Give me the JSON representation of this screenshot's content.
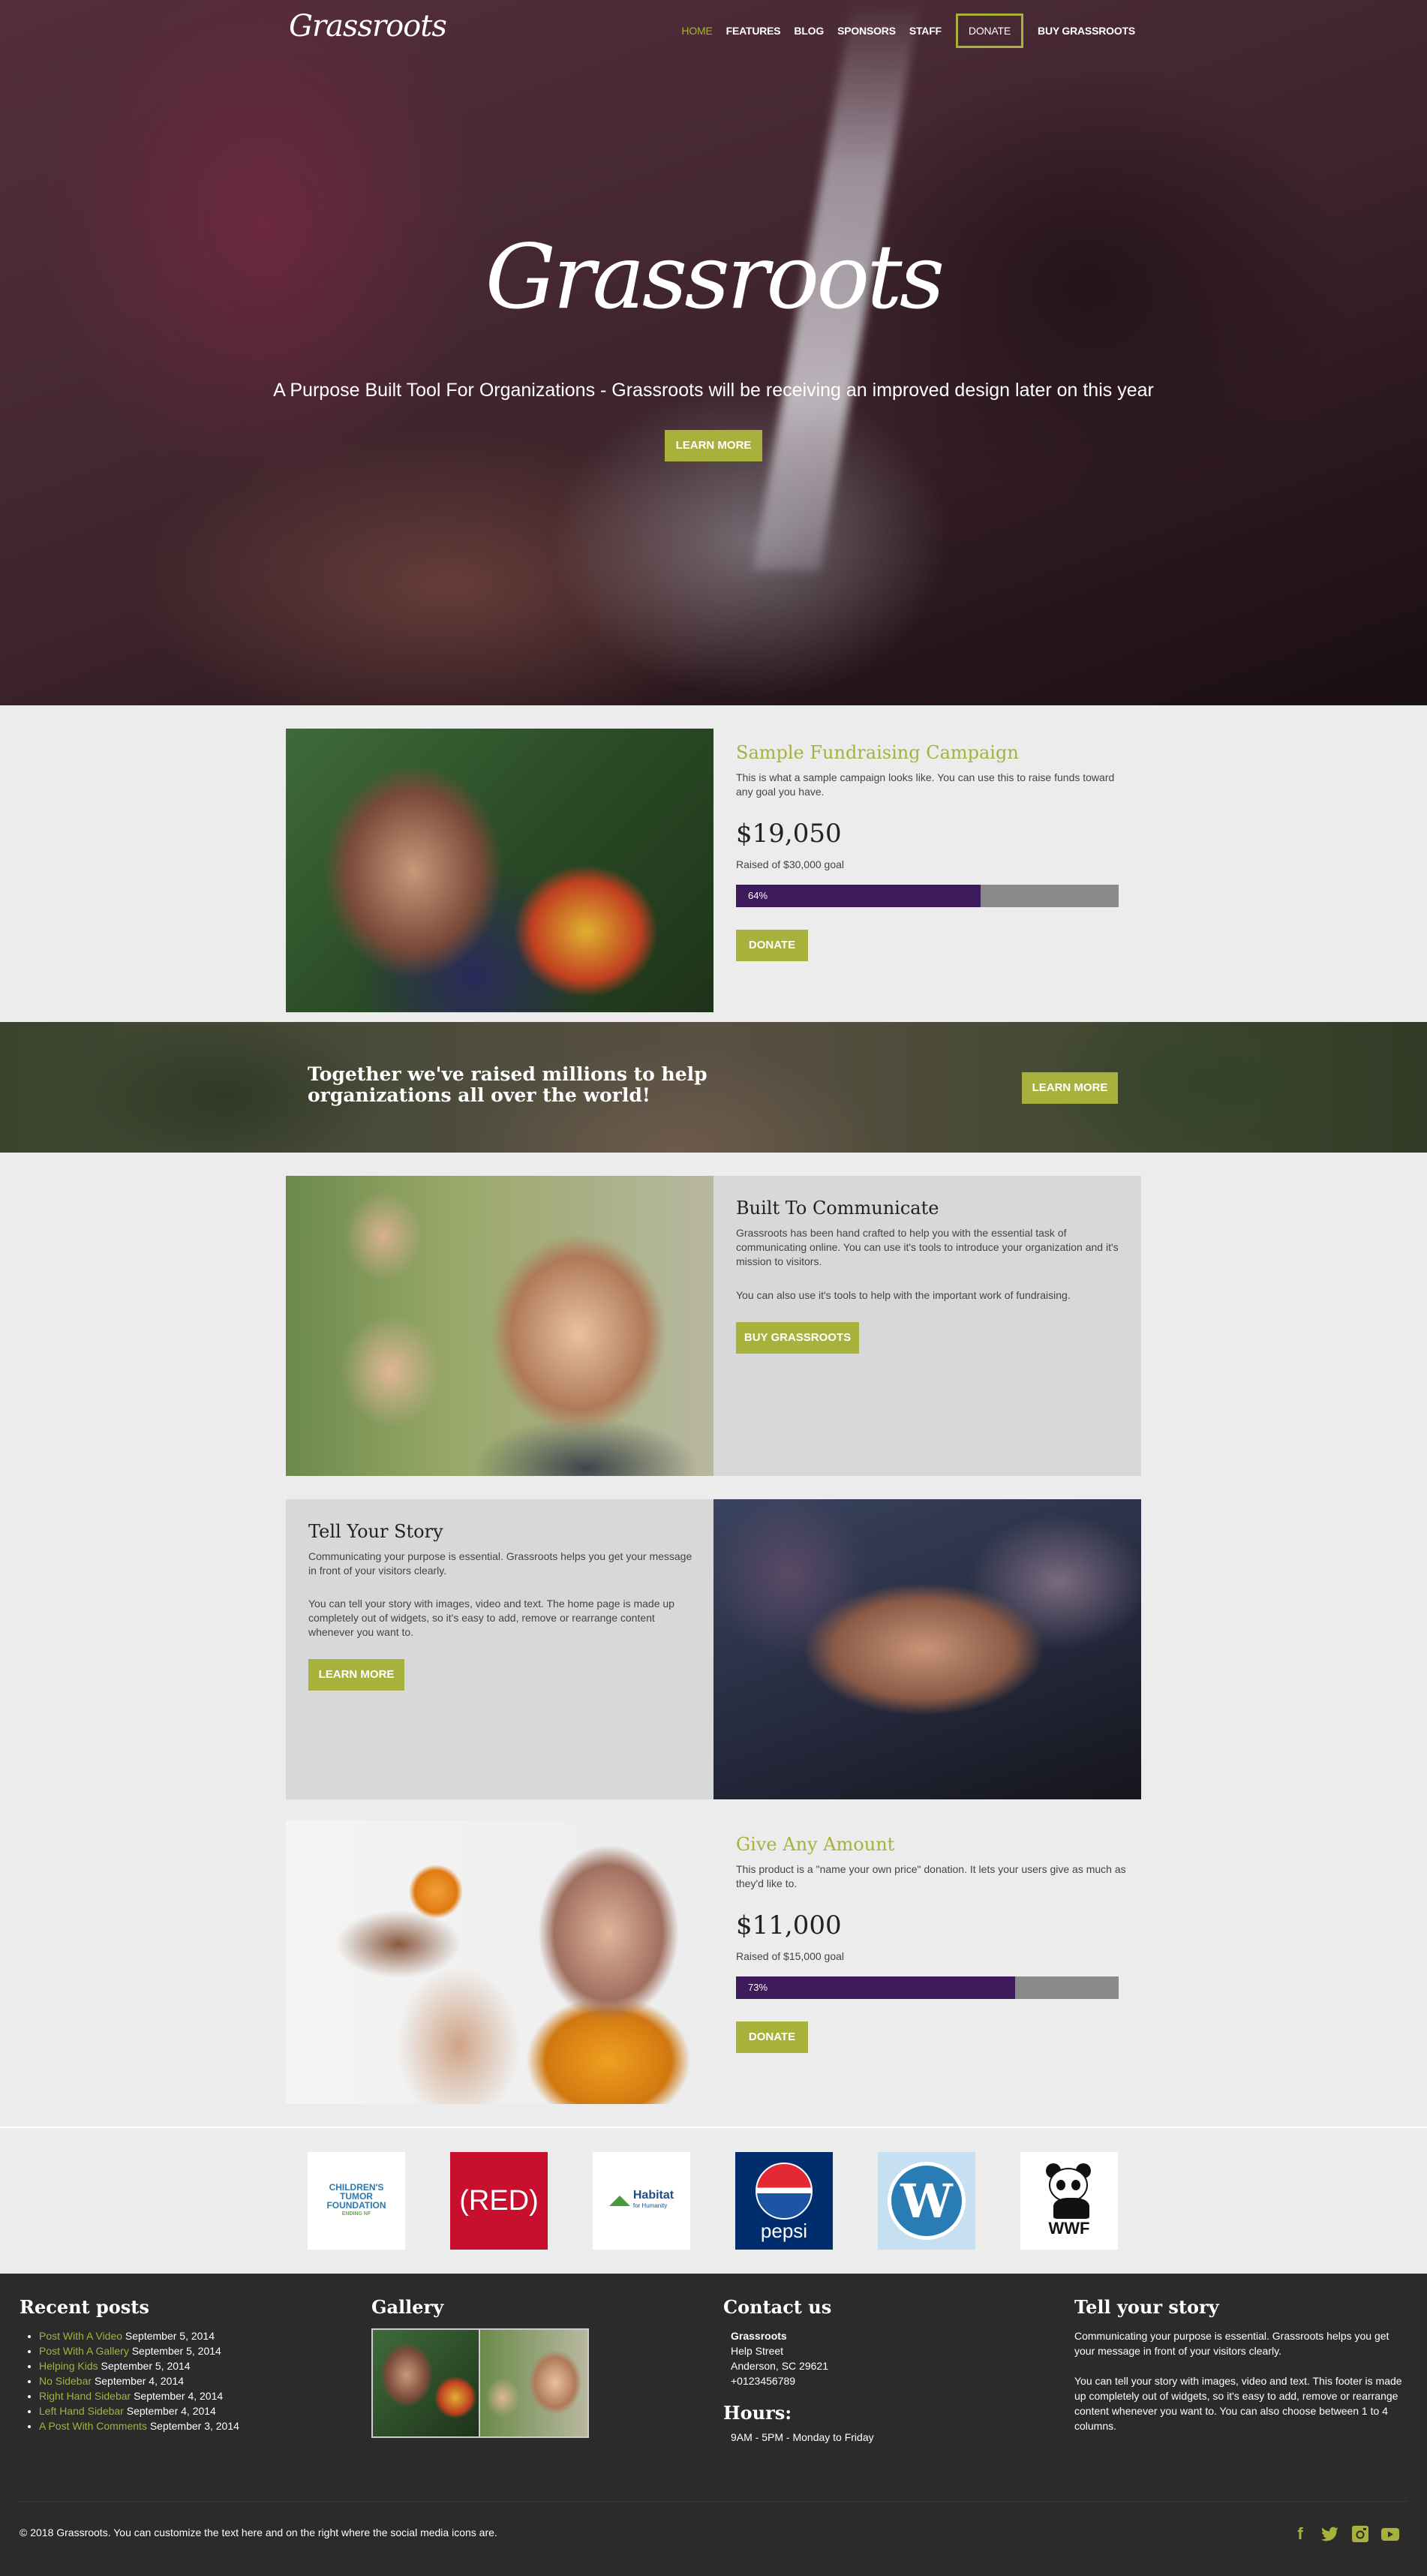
{
  "nav": {
    "logo": "Grassroots",
    "items": [
      "HOME",
      "FEATURES",
      "BLOG",
      "SPONSORS",
      "STAFF",
      "DONATE",
      "BUY GRASSROOTS"
    ]
  },
  "hero": {
    "title": "Grassroots",
    "subtitle": "A Purpose Built Tool For Organizations - Grassroots will be receiving an improved design later on this year",
    "button": "LEARN MORE"
  },
  "campaign1": {
    "title": "Sample Fundraising Campaign",
    "description": "This is what a sample campaign looks like. You can use this to raise funds toward any goal you have.",
    "amount": "$19,050",
    "goal": "Raised of $30,000 goal",
    "progress_label": "64%",
    "progress": 0.64,
    "button": "DONATE"
  },
  "banner": {
    "text": "Together we've raised millions to help organizations all over the world!",
    "button": "LEARN MORE"
  },
  "communicate": {
    "title": "Built To Communicate",
    "p1": "Grassroots has been hand crafted to help you with the essential task of communicating online. You can use it's tools to introduce your organization and it's mission to visitors.",
    "p2": "You can also use it's tools to help with the important work of fundraising.",
    "button": "BUY GRASSROOTS"
  },
  "story": {
    "title": "Tell Your Story",
    "p1": "Communicating your purpose is essential. Grassroots helps you get your message in front of your visitors clearly.",
    "p2": "You can tell your story with images, video and text. The home page is made up completely out of widgets, so it's easy to add, remove or rearrange content whenever you want to.",
    "button": "LEARN MORE"
  },
  "campaign2": {
    "title": "Give Any Amount",
    "description": "This product is a \"name your own price\" donation. It lets your users give as much as they'd like to.",
    "amount": "$11,000",
    "goal": "Raised of $15,000 goal",
    "progress_label": "73%",
    "progress": 0.73,
    "button": "DONATE"
  },
  "sponsors": {
    "ctf": [
      "CHILDREN'S",
      "TUMOR",
      "FOUNDATION",
      "ENDING NF"
    ],
    "red": "(RED)",
    "habitat": [
      "Habitat",
      "for Humanity"
    ],
    "pepsi": "pepsi",
    "wordpress": "W",
    "wwf": "WWF"
  },
  "footer": {
    "recent_title": "Recent posts",
    "recent_posts": [
      {
        "title": "Post With A Video",
        "date": "September 5, 2014"
      },
      {
        "title": "Post With A Gallery",
        "date": "September 5, 2014"
      },
      {
        "title": "Helping Kids",
        "date": "September 5, 2014"
      },
      {
        "title": "No Sidebar",
        "date": "September 4, 2014"
      },
      {
        "title": "Right Hand Sidebar",
        "date": "September 4, 2014"
      },
      {
        "title": "Left Hand Sidebar",
        "date": "September 4, 2014"
      },
      {
        "title": "A Post With Comments",
        "date": "September 3, 2014"
      }
    ],
    "gallery_title": "Gallery",
    "contact_title": "Contact us",
    "contact_name": "Grassroots",
    "contact_street": "Help Street",
    "contact_city": "Anderson, SC 29621",
    "contact_phone": "+0123456789",
    "hours_title": "Hours:",
    "hours": "9AM - 5PM - Monday to Friday",
    "story_title": "Tell your story",
    "story_p1": "Communicating your purpose is essential. Grassroots helps you get your message in front of your visitors clearly.",
    "story_p2": "You can tell your story with images, video and text. This footer is made up completely out of widgets, so it's easy to add, remove or rearrange content whenever you want to. You can also choose between 1 to 4 columns.",
    "copyright": "© 2018 Grassroots. You can customize the text here and on the right where the social media icons are.",
    "social": [
      "facebook-icon",
      "twitter-icon",
      "instagram-icon",
      "youtube-icon"
    ]
  },
  "colors": {
    "accent": "#a8b13c",
    "progress": "#3d1a5c",
    "footer": "#2b2b2b"
  }
}
